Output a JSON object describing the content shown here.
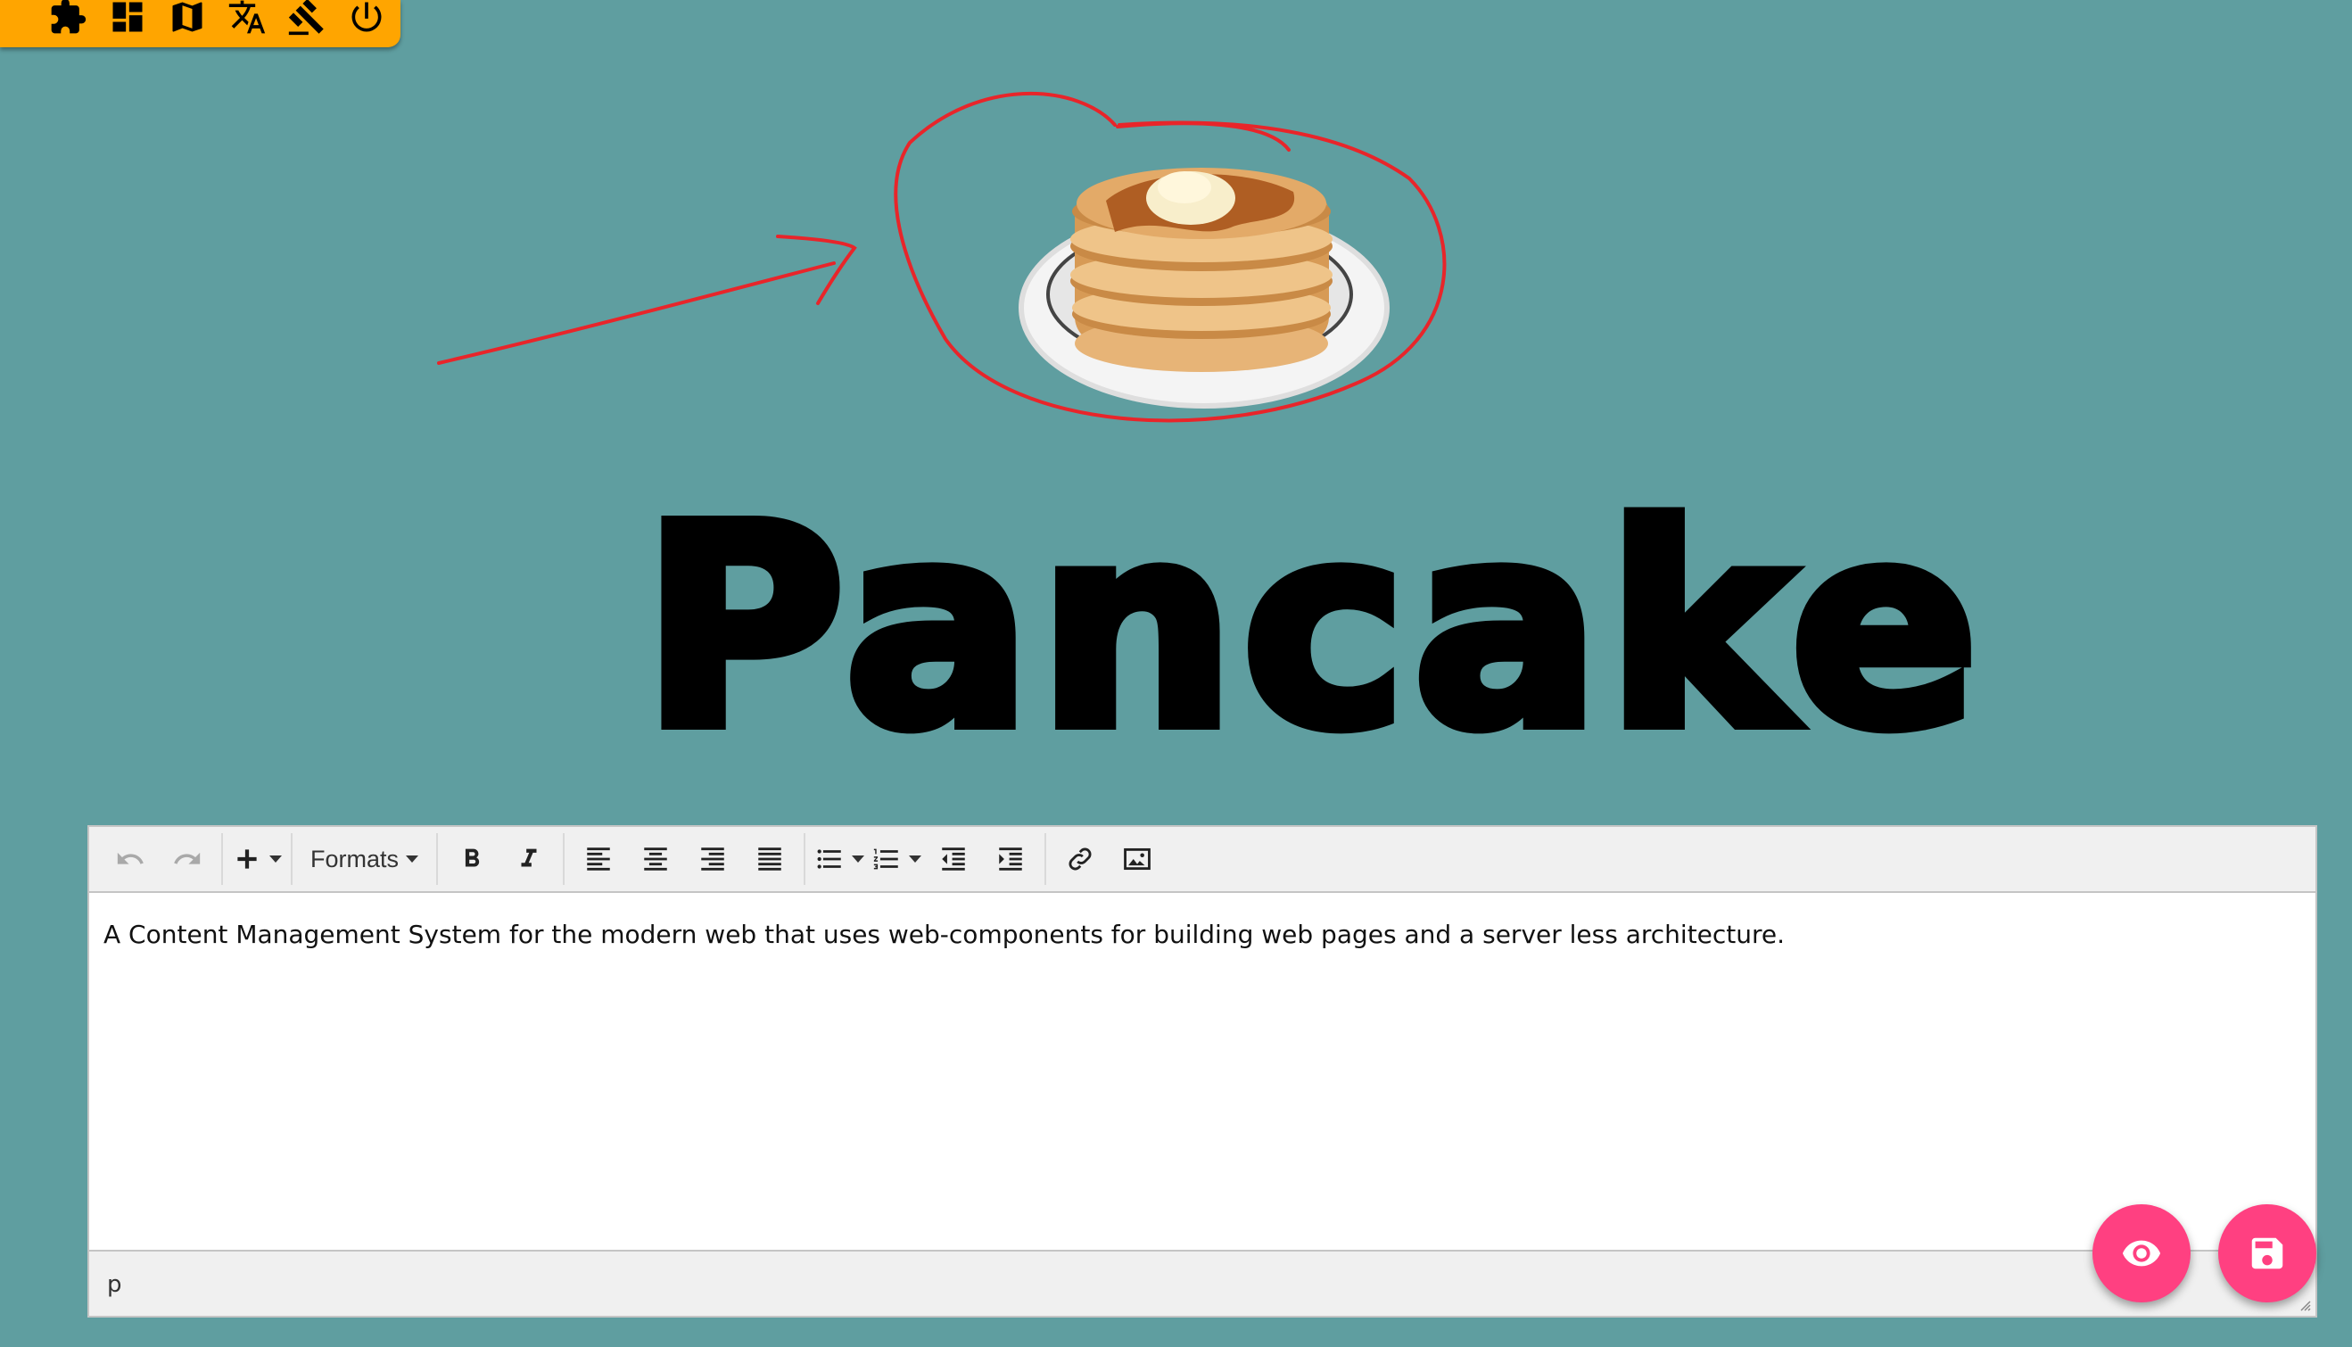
{
  "topbar": {
    "icons": [
      "puzzle-icon",
      "dashboard-icon",
      "map-icon",
      "translate-icon",
      "gavel-icon",
      "power-icon"
    ]
  },
  "hero": {
    "logo_text": "Pancake",
    "image": "pancake-stack-image"
  },
  "editor": {
    "toolbar": {
      "formats_label": "Formats",
      "buttons": [
        "undo",
        "redo",
        "insert",
        "bold",
        "italic",
        "align-left",
        "align-center",
        "align-right",
        "justify",
        "bullet-list",
        "numbered-list",
        "outdent",
        "indent",
        "link",
        "image"
      ]
    },
    "content": "A Content Management System for the modern web that uses web-components for building web pages and a server less architecture.",
    "status_path": "p"
  },
  "fabs": [
    "preview-eye-icon",
    "save-disk-icon"
  ],
  "colors": {
    "background": "#5f9ea0",
    "topbar": "#ffa500",
    "fab": "#ff4081",
    "annotation": "#e8252a"
  }
}
